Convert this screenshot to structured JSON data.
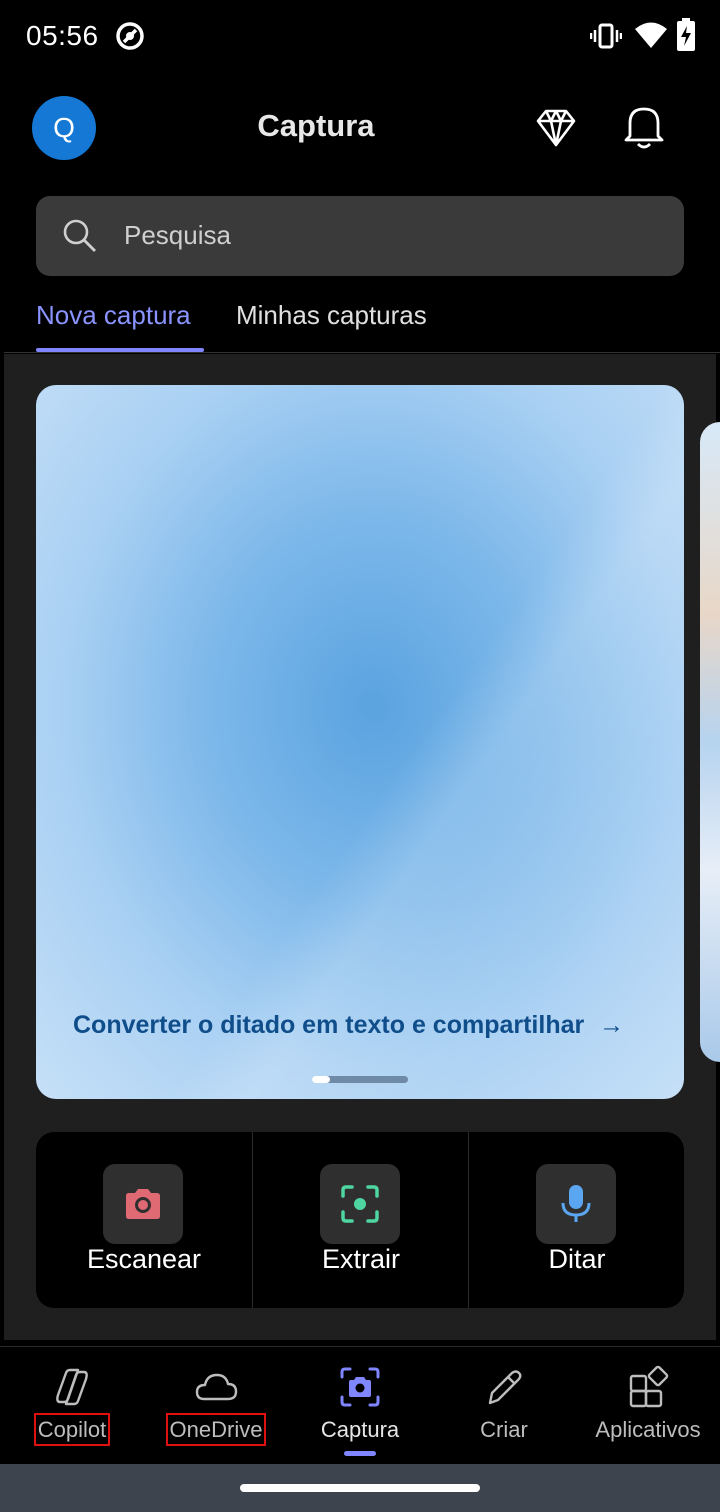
{
  "status_bar": {
    "time": "05:56",
    "icons": [
      "sync-icon",
      "vibrate-icon",
      "wifi-icon",
      "battery-charging-icon"
    ]
  },
  "header": {
    "avatar_initial": "Q",
    "title": "Captura",
    "icons": [
      "premium-diamond-icon",
      "notifications-bell-icon"
    ]
  },
  "search": {
    "placeholder": "Pesquisa"
  },
  "tabs": [
    {
      "label": "Nova captura",
      "active": true
    },
    {
      "label": "Minhas capturas",
      "active": false
    }
  ],
  "carousel": {
    "caption": "Converter o ditado em texto e compartilhar",
    "caption_arrow": "→",
    "page_index": 1,
    "page_count": 2
  },
  "actions": [
    {
      "label": "Escanear",
      "icon": "camera-icon",
      "color": "#e06a74"
    },
    {
      "label": "Extrair",
      "icon": "scan-text-icon",
      "color": "#4fd6a0"
    },
    {
      "label": "Ditar",
      "icon": "microphone-icon",
      "color": "#5aa6f0"
    }
  ],
  "bottom_nav": [
    {
      "label": "Copilot",
      "icon": "copilot-icon",
      "active": false
    },
    {
      "label": "OneDrive",
      "icon": "cloud-icon",
      "active": false
    },
    {
      "label": "Captura",
      "icon": "capture-camera-icon",
      "active": true
    },
    {
      "label": "Criar",
      "icon": "pen-icon",
      "active": false
    },
    {
      "label": "Aplicativos",
      "icon": "apps-grid-icon",
      "active": false
    }
  ],
  "colors": {
    "accent": "#7f86ff",
    "avatar": "#1478d4",
    "caption_text": "#0f4e8a"
  }
}
